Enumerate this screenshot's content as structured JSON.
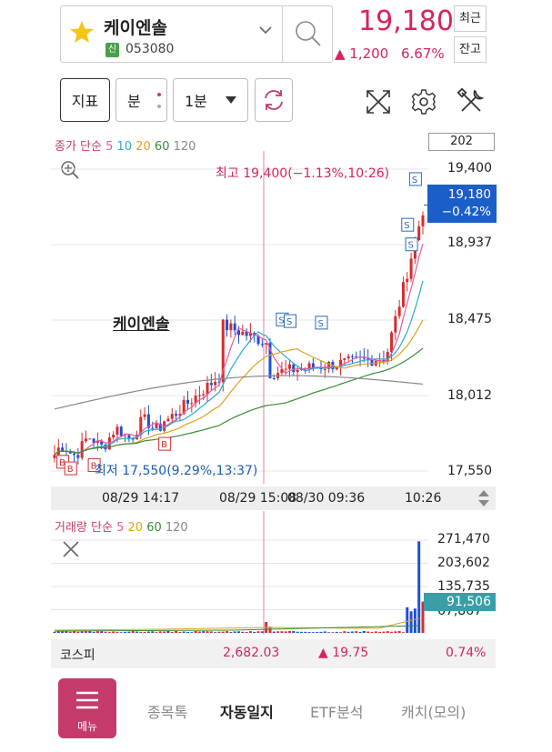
{
  "header": {
    "stock_name": "케이엔솔",
    "badge": "신",
    "code": "053080",
    "price": "19,180",
    "change": "▲ 1,200",
    "change_pct": "6.67%",
    "recent_label": "최근",
    "balance_label": "잔고"
  },
  "toolbar": {
    "indicator_label": "지표",
    "period_label": "분",
    "minute_select": "1분"
  },
  "chart": {
    "ma_legend": {
      "prefix": "종가 단순",
      "periods": [
        "5",
        "10",
        "20",
        "60",
        "120"
      ]
    },
    "count": "202",
    "stock_label": "케이엔솔",
    "high_label": "최고 19,400(−1.13%,10:26)",
    "low_label": "최저 17,550(9.29%,13:37)",
    "current_price": "19,180",
    "current_pct": "−0.42%",
    "times": [
      "08/29 14:17",
      "08/29 15:08",
      "08/30 09:36",
      "10:26"
    ],
    "colors": {
      "up": "#d62d2d",
      "down": "#1f4fd6",
      "ma5": "#e85aa0",
      "ma10": "#2aa9d8",
      "ma20": "#e0a21a",
      "ma60": "#3a8c3a",
      "ma120": "#888888"
    }
  },
  "chart_data": {
    "type": "candlestick",
    "yticks": [
      19400,
      18937,
      18475,
      18012,
      17550
    ],
    "high": 19400,
    "low": 17550,
    "current": 19180,
    "volume_yticks": [
      271470,
      203602,
      135735,
      67867
    ],
    "current_volume": 91506
  },
  "price_ticks": [
    "19,400",
    "18,937",
    "18,475",
    "18,012",
    "17,550"
  ],
  "volume": {
    "legend": {
      "prefix": "거래량 단순",
      "periods": [
        "5",
        "20",
        "60",
        "120"
      ]
    },
    "ticks": [
      "271,470",
      "203,602",
      "135,735",
      "67,867"
    ],
    "current": "91,506"
  },
  "index": {
    "name": "코스피",
    "value": "2,682.03",
    "change": "▲ 19.75",
    "pct": "0.74%"
  },
  "nav": {
    "menu": "메뉴",
    "items": [
      "종목톡",
      "자동일지",
      "ETF분석",
      "캐치(모의)"
    ]
  }
}
